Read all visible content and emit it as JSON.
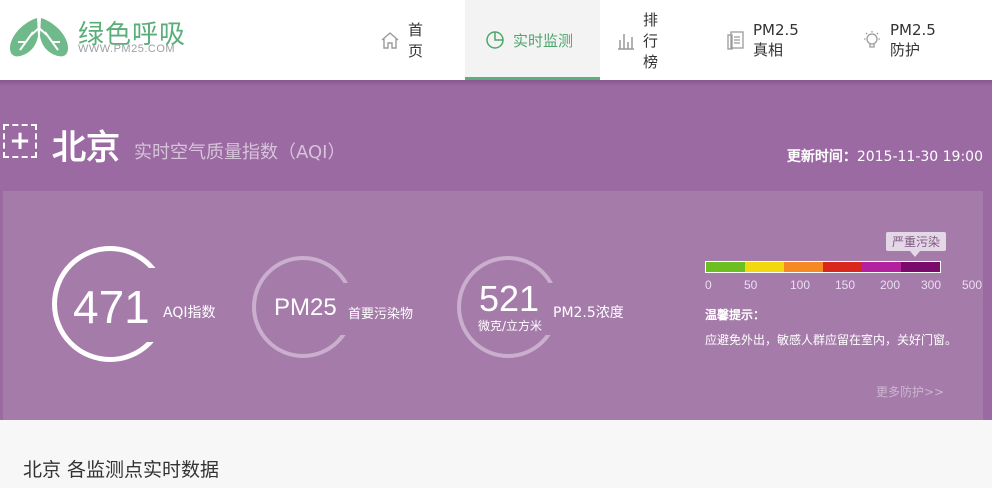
{
  "brand": {
    "title": "绿色呼吸",
    "url": "WWW.PM25.COM"
  },
  "nav": [
    {
      "label": "首页",
      "icon": "home-icon",
      "active": false
    },
    {
      "label": "实时监测",
      "icon": "pie-chart-icon",
      "active": true
    },
    {
      "label": "排行榜",
      "icon": "bar-chart-icon",
      "active": false
    },
    {
      "label": "PM2.5真相",
      "icon": "document-icon",
      "active": false
    },
    {
      "label": "PM2.5防护",
      "icon": "lightbulb-icon",
      "active": false
    }
  ],
  "city": {
    "name": "北京",
    "subtitle": "实时空气质量指数（AQI）",
    "update_label": "更新时间：",
    "update_time": "2015-11-30 19:00"
  },
  "metrics": {
    "aqi_value": "471",
    "aqi_label": "AQI指数",
    "primary_value": "PM25",
    "primary_label": "首要污染物",
    "concentration_value": "521",
    "concentration_unit": "微克/立方米",
    "concentration_label": "PM2.5浓度"
  },
  "scale": {
    "level_badge": "严重污染",
    "colors": [
      "#6bbf21",
      "#f1d80f",
      "#f58a22",
      "#d8271b",
      "#b4219e",
      "#7a0b6c"
    ],
    "ticks": [
      "0",
      "50",
      "100",
      "150",
      "200",
      "300",
      "500"
    ]
  },
  "tip": {
    "title": "温馨提示：",
    "text": "应避免外出，敏感人群应留在室内，关好门窗。",
    "more": "更多防护>>"
  },
  "section": {
    "title": "北京 各监测点实时数据"
  }
}
